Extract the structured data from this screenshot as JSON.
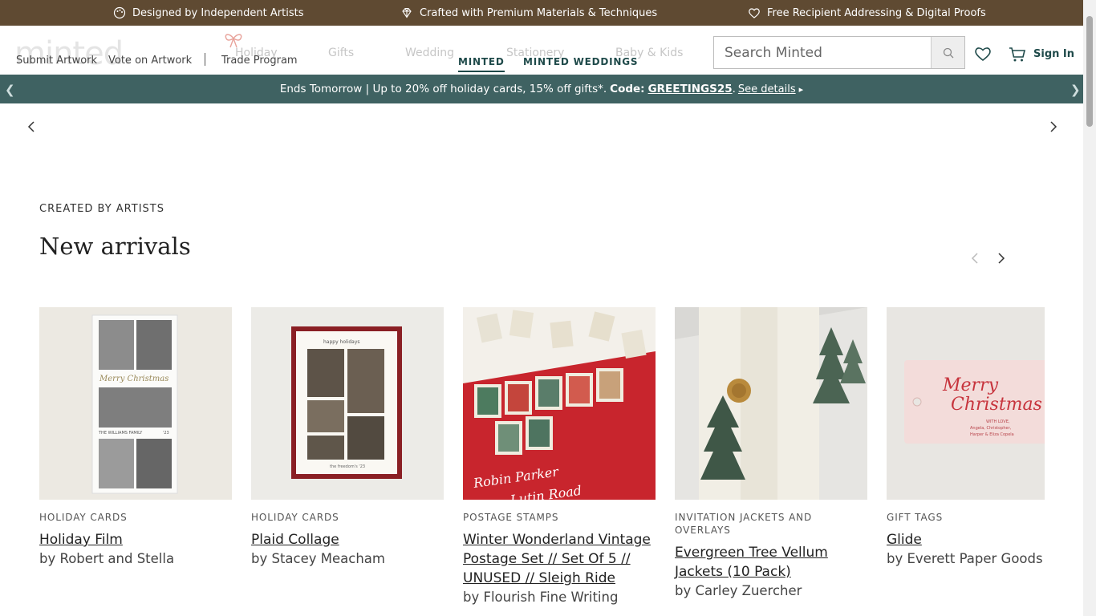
{
  "topbar": {
    "items": [
      {
        "icon": "palette-icon",
        "label": "Designed by Independent Artists"
      },
      {
        "icon": "diamond-icon",
        "label": "Crafted with Premium Materials & Techniques"
      },
      {
        "icon": "heart-icon",
        "label": "Free Recipient Addressing & Digital Proofs"
      }
    ]
  },
  "header": {
    "logo": "minted.",
    "nav_ghost": [
      "Holiday",
      "Gifts",
      "Wedding",
      "Stationery",
      "Baby & Kids"
    ],
    "util_links": [
      "Submit Artwork",
      "Vote on Artwork",
      "Trade Program"
    ],
    "brand_tabs": [
      "MINTED",
      "MINTED WEDDINGS"
    ],
    "search_placeholder": "Search Minted",
    "sign_in": "Sign In"
  },
  "promo": {
    "text": "Ends Tomorrow | Up to 20% off holiday cards, 15% off gifts*.",
    "code_label": "Code:",
    "code": "GREETINGS25",
    "details": "See details",
    "details_arrow": "▸"
  },
  "section": {
    "eyebrow": "CREATED BY ARTISTS",
    "title": "New arrivals"
  },
  "cards": [
    {
      "category": "HOLIDAY CARDS",
      "title": "Holiday Film",
      "by": "by Robert and Stella"
    },
    {
      "category": "HOLIDAY CARDS",
      "title": "Plaid Collage",
      "by": "by Stacey Meacham"
    },
    {
      "category": "POSTAGE STAMPS",
      "title": "Winter Wonderland Vintage Postage Set // Set Of 5 // UNUSED // Sleigh Ride",
      "by": "by Flourish Fine Writing"
    },
    {
      "category": "INVITATION JACKETS AND OVERLAYS",
      "title": "Evergreen Tree Vellum Jackets (10 Pack)",
      "by": "by Carley Zuercher"
    },
    {
      "category": "GIFT TAGS",
      "title": "Glide",
      "by": "by Everett Paper Goods"
    }
  ],
  "card_art": {
    "card1_script": "Merry Christmas",
    "card1_footer": "THE WILLIAMS FAMILY",
    "card1_year": "'23",
    "card2_header": "happy holidays",
    "card2_footer": "the freedom's '23",
    "card3_address": [
      "Robin Parker",
      "Lutin Road"
    ],
    "card5_script": [
      "Merry",
      "Christmas"
    ],
    "card5_small": [
      "WITH LOVE,",
      "Angela, Christopher,",
      "Harper & Eliza Copela"
    ]
  },
  "colors": {
    "topbar": "#5f4a32",
    "promo": "#3f6262",
    "accent": "#1f4a4a"
  }
}
